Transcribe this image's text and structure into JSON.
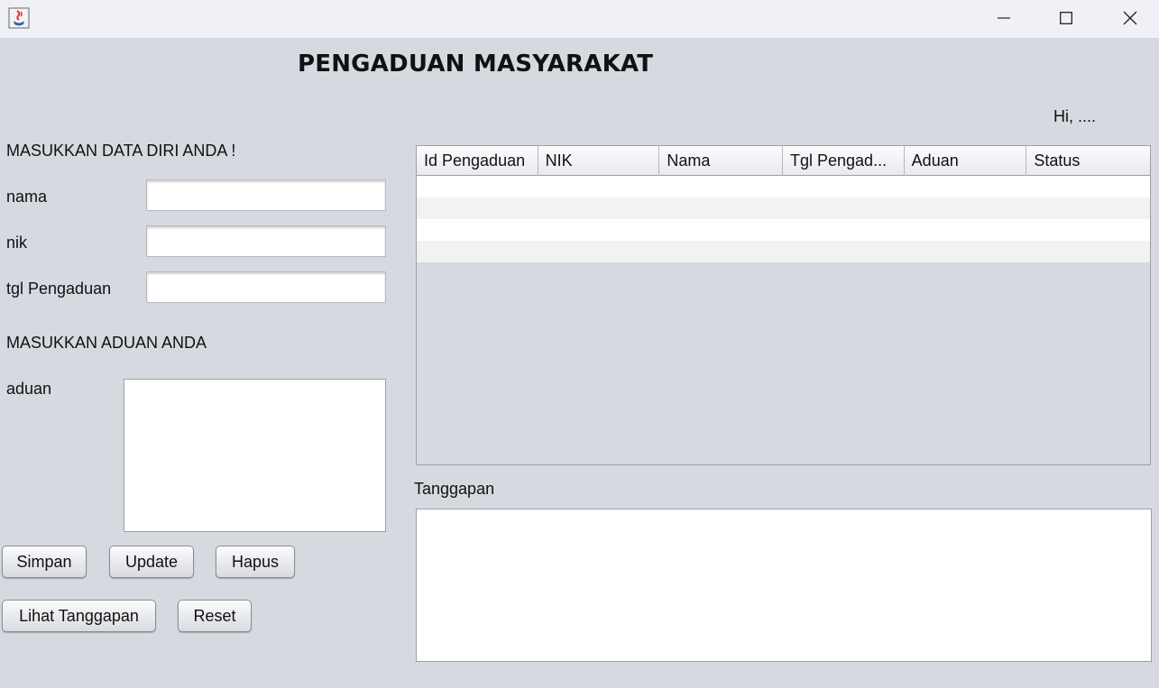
{
  "window": {
    "app_icon": "java-cup-icon",
    "controls": [
      "minimize-icon",
      "maximize-icon",
      "close-icon"
    ]
  },
  "header": {
    "title": "PENGADUAN MASYARAKAT",
    "greeting": "Hi, ...."
  },
  "form": {
    "section_data_label": "MASUKKAN DATA DIRI ANDA !",
    "nama_label": "nama",
    "nama_value": "",
    "nik_label": "nik",
    "nik_value": "",
    "tgl_label": "tgl Pengaduan",
    "tgl_value": "",
    "section_aduan_label": "MASUKKAN ADUAN ANDA",
    "aduan_label": "aduan",
    "aduan_value": ""
  },
  "buttons": {
    "simpan": "Simpan",
    "update": "Update",
    "hapus": "Hapus",
    "lihat_tanggapan": "Lihat Tanggapan",
    "reset": "Reset"
  },
  "table": {
    "columns": [
      "Id Pengaduan",
      "NIK",
      "Nama",
      "Tgl Pengad...",
      "Aduan",
      "Status"
    ],
    "rows": [
      [
        "",
        "",
        "",
        "",
        "",
        ""
      ],
      [
        "",
        "",
        "",
        "",
        "",
        ""
      ],
      [
        "",
        "",
        "",
        "",
        "",
        ""
      ],
      [
        "",
        "",
        "",
        "",
        "",
        ""
      ]
    ]
  },
  "tanggapan": {
    "label": "Tanggapan",
    "value": ""
  },
  "colors": {
    "background": "#d6d9e0",
    "titlebar": "#eff1f6",
    "row_even": "#ffffff",
    "row_odd": "#f2f2f2"
  }
}
